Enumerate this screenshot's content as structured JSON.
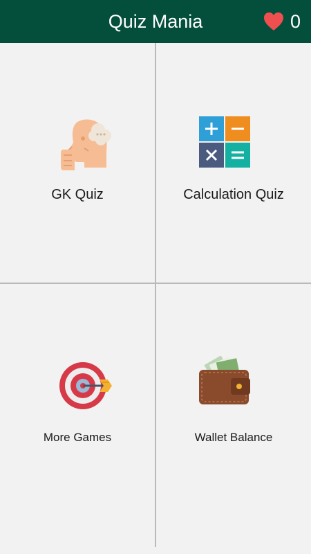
{
  "header": {
    "title": "Quiz Mania",
    "lives_count": "0",
    "heart_icon": "heart-icon",
    "background_color": "#044f3c",
    "heart_color": "#ef4f4f"
  },
  "tiles": [
    {
      "label": "GK Quiz",
      "icon": "thinking-head-icon"
    },
    {
      "label": "Calculation Quiz",
      "icon": "calculator-icon"
    },
    {
      "label": "More Games",
      "icon": "target-icon"
    },
    {
      "label": "Wallet Balance",
      "icon": "wallet-icon"
    }
  ]
}
